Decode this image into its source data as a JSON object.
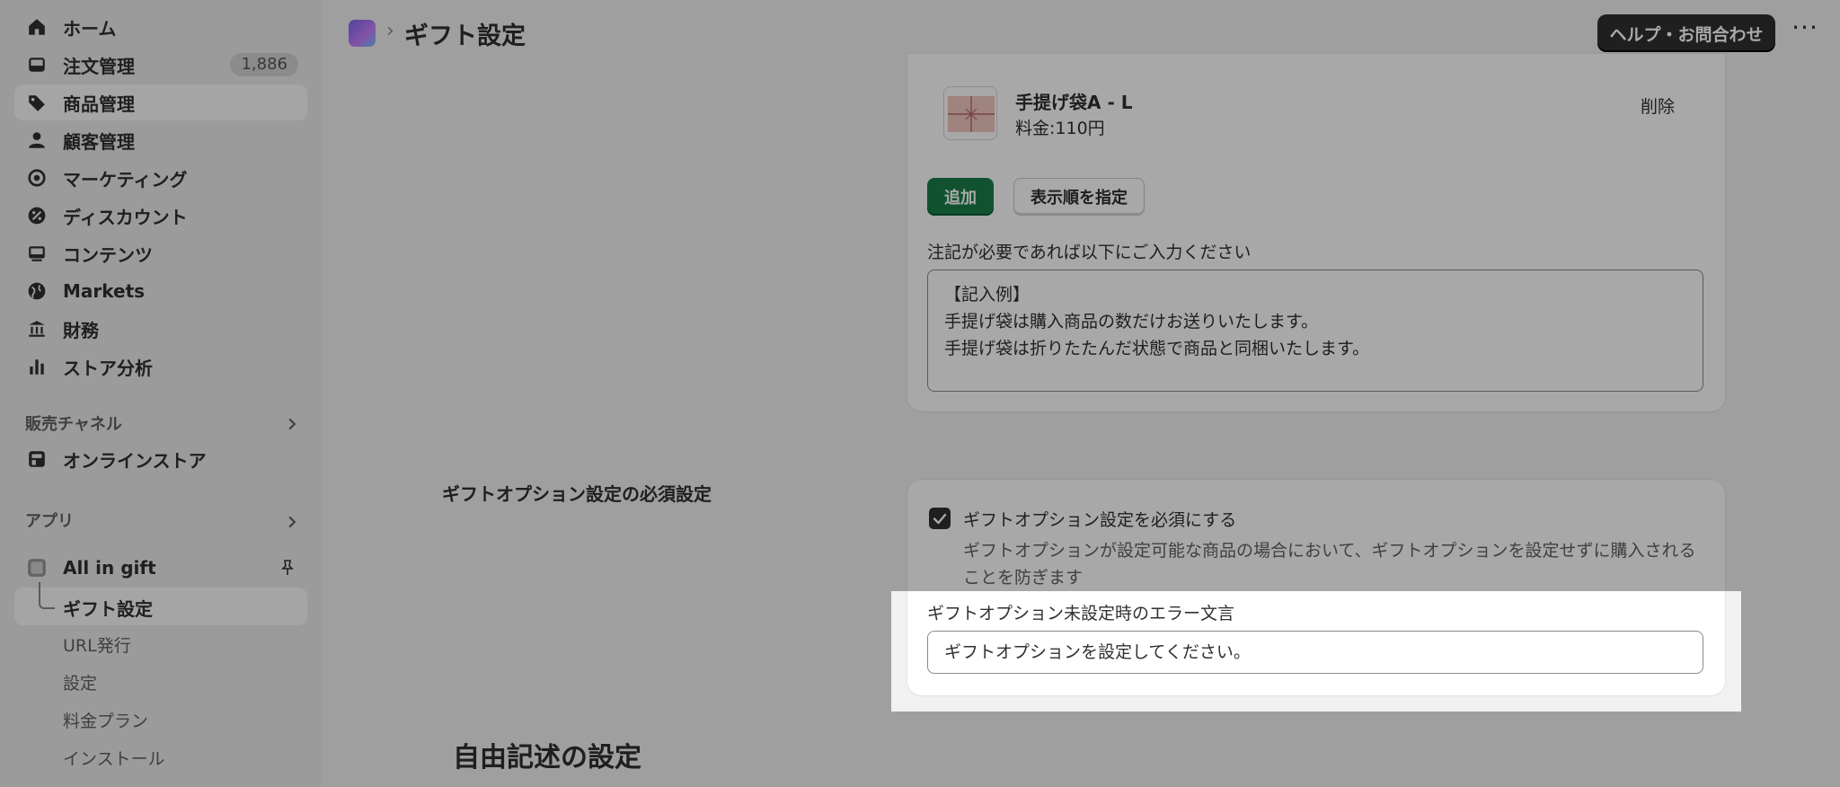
{
  "sidebar": {
    "items": [
      {
        "label": "ホーム",
        "icon": "home-icon"
      },
      {
        "label": "注文管理",
        "icon": "inbox-icon",
        "badge": "1,886"
      },
      {
        "label": "商品管理",
        "icon": "tag-icon"
      },
      {
        "label": "顧客管理",
        "icon": "person-icon"
      },
      {
        "label": "マーケティング",
        "icon": "target-icon"
      },
      {
        "label": "ディスカウント",
        "icon": "discount-icon"
      },
      {
        "label": "コンテンツ",
        "icon": "content-icon"
      },
      {
        "label": "Markets",
        "icon": "globe-icon"
      },
      {
        "label": "財務",
        "icon": "bank-icon"
      },
      {
        "label": "ストア分析",
        "icon": "bar-chart-icon"
      }
    ],
    "sales_channels": {
      "heading": "販売チャネル",
      "items": [
        {
          "label": "オンラインストア",
          "icon": "store-icon"
        }
      ]
    },
    "apps": {
      "heading": "アプリ",
      "app": {
        "label": "All in gift",
        "icon": "app-icon"
      },
      "sub_items": [
        "ギフト設定",
        "URL発行",
        "設定",
        "料金プラン",
        "インストール"
      ]
    }
  },
  "topbar": {
    "breadcrumb_sep": "›",
    "title": "ギフト設定",
    "help_button": "ヘルプ・お問合わせ",
    "more": "···"
  },
  "product": {
    "name": "手提げ袋A - L",
    "price": "料金:110円",
    "delete": "削除"
  },
  "buttons": {
    "add": "追加",
    "set_order": "表示順を指定"
  },
  "note": {
    "label": "注記が必要であれば以下にご入力ください",
    "value": "【記入例】\n手提げ袋は購入商品の数だけお送りいたします。\n手提げ袋は折りたたんだ状態で商品と同梱いたします。"
  },
  "required_setting": {
    "section_label": "ギフトオプション設定の必須設定",
    "checkbox_label": "ギフトオプション設定を必須にする",
    "checked": true,
    "help": "ギフトオプションが設定可能な商品の場合において、ギフトオプションを設定せずに購入されることを防ぎます",
    "error_label": "ギフトオプション未設定時のエラー文言",
    "error_value": "ギフトオプションを設定してください。"
  },
  "free_text": {
    "title": "自由記述の設定"
  },
  "colors": {
    "accent_green": "#1a7f4b",
    "dark_button": "#303030",
    "overlay": "rgba(0,0,0,0.34)"
  }
}
